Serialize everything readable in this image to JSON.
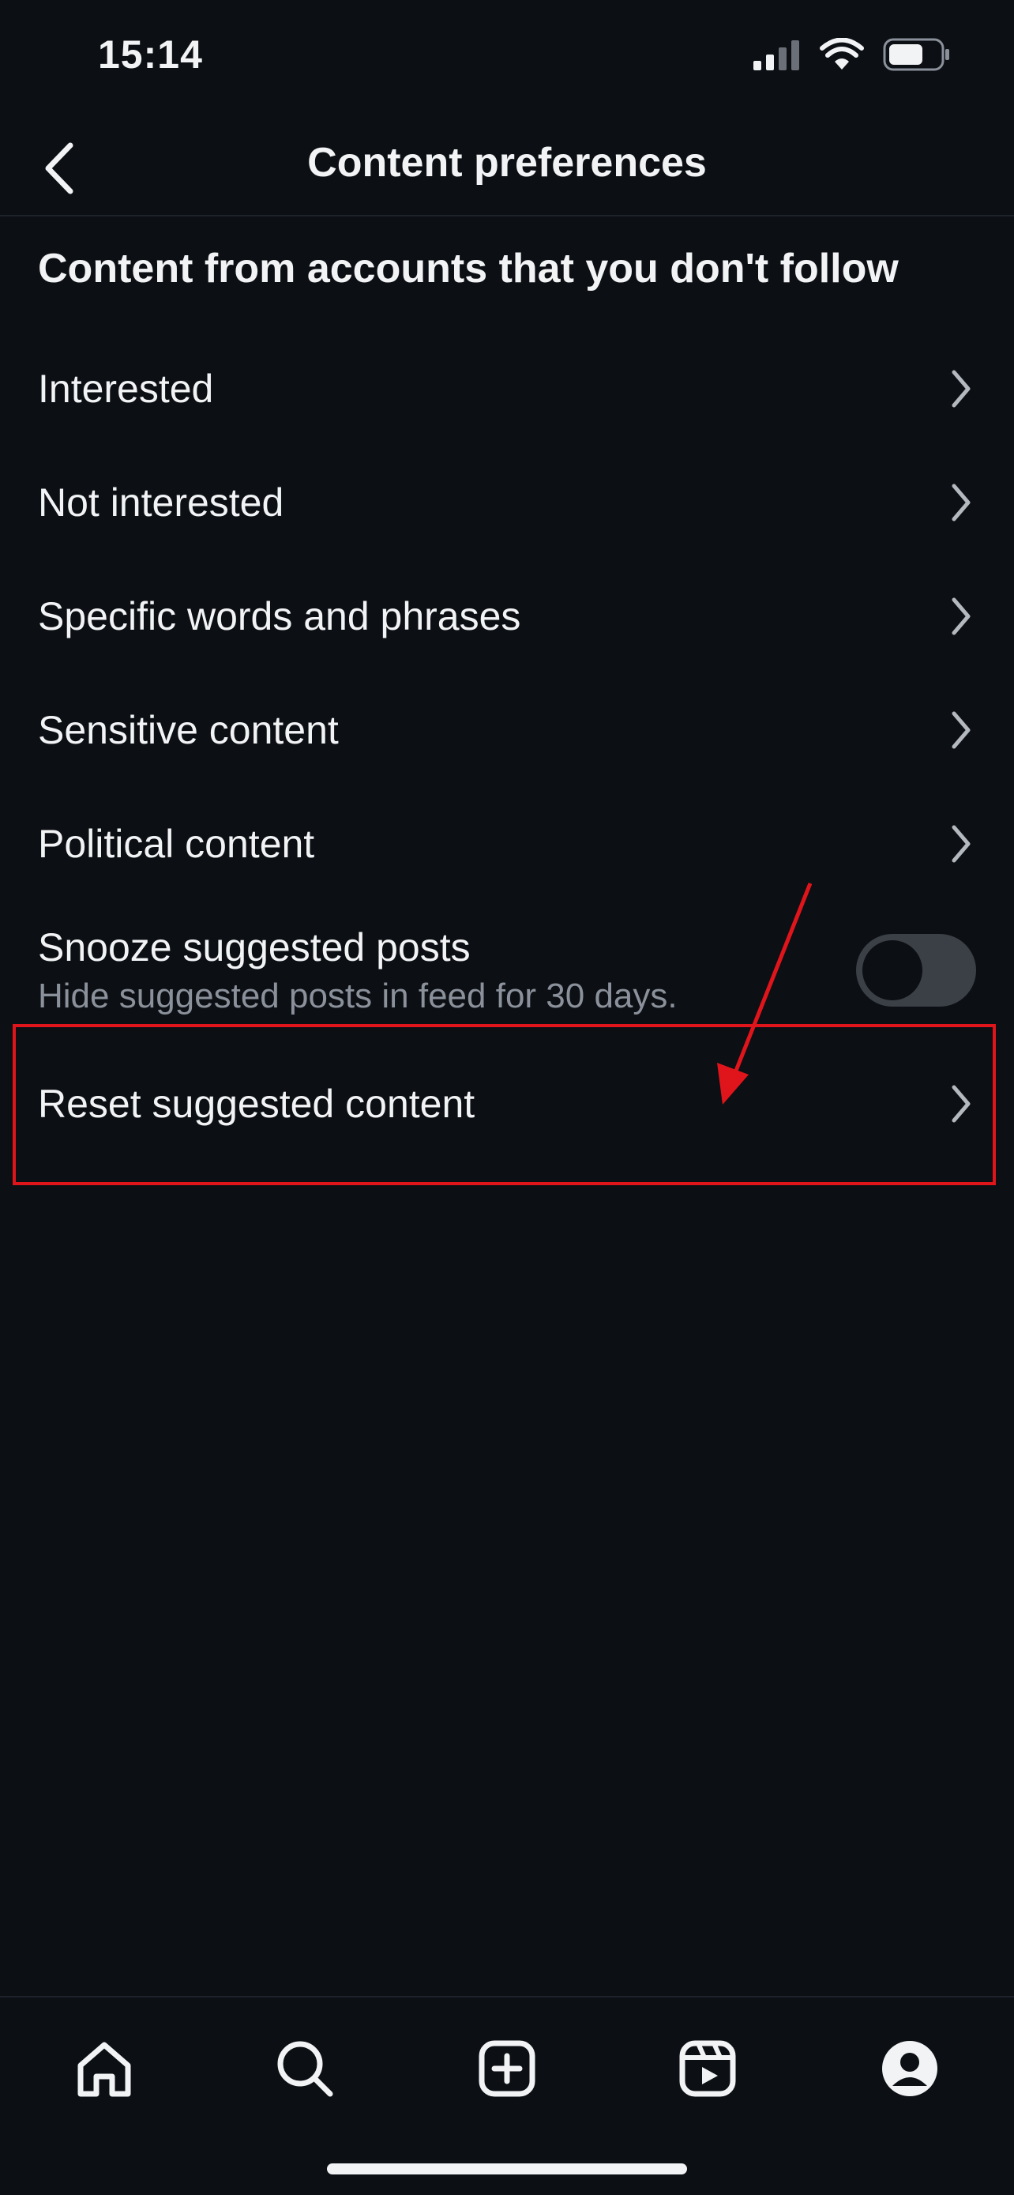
{
  "status_bar": {
    "time": "15:14",
    "icons": [
      "cellular-signal-icon",
      "wifi-icon",
      "battery-icon"
    ]
  },
  "header": {
    "title": "Content preferences",
    "back_icon": "chevron-left-icon"
  },
  "section": {
    "heading": "Content from accounts that you don't follow"
  },
  "menu_items": [
    {
      "label": "Interested"
    },
    {
      "label": "Not interested"
    },
    {
      "label": "Specific words and phrases"
    },
    {
      "label": "Sensitive content"
    },
    {
      "label": "Political content"
    }
  ],
  "snooze": {
    "title": "Snooze suggested posts",
    "subtitle": "Hide suggested posts in feed for 30 days.",
    "enabled": false
  },
  "reset": {
    "label": "Reset suggested content"
  },
  "tab_bar": {
    "tabs": [
      "home-icon",
      "search-icon",
      "create-post-icon",
      "reels-icon",
      "profile-icon"
    ]
  },
  "colors": {
    "background": "#0c0f14",
    "text": "#f2f3f5",
    "secondary_text": "#8b919b",
    "toggle_off": "#3b3f46",
    "annotation": "#e0151b"
  }
}
